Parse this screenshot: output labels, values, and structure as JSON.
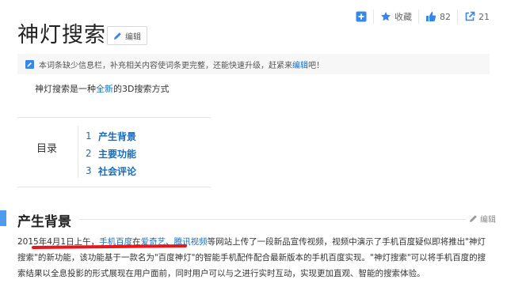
{
  "actions": {
    "add_icon": "plus-square-icon",
    "favorite": {
      "icon": "star-icon",
      "label": "收藏"
    },
    "like": {
      "icon": "thumbs-up-icon",
      "count": "82"
    },
    "share": {
      "icon": "share-icon",
      "count": "21"
    }
  },
  "page_title": "神灯搜索",
  "edit_label": "编辑",
  "notice": {
    "text_before": "本词条缺少信息栏，补充相关内容使词条更完整，还能快速升级，赶紧来",
    "link": "编辑",
    "text_after": "吧！"
  },
  "summary": {
    "before": "神灯搜索是一种",
    "link": "全新",
    "after": "的3D搜索方式"
  },
  "toc": {
    "label": "目录",
    "items": [
      {
        "num": "1",
        "label": "产生背景"
      },
      {
        "num": "2",
        "label": "主要功能"
      },
      {
        "num": "3",
        "label": "社会评论"
      }
    ]
  },
  "section": {
    "title": "产生背景",
    "edit_label": "编辑"
  },
  "paragraph": {
    "date": "2015年4月1日上午，",
    "link1": "手机百度",
    "t1": "在",
    "link2": "爱奇艺",
    "t2": "、",
    "link3": "腾讯视频",
    "t3": "等网站上传了一段新品宣传视频，视频中演示了手机百度疑似即将推出\"神灯搜索\"的新功能，该功能基于一款名为\"百度神灯\"的智能手机配件配合最新版本的手机百度实现。\"神灯搜索\"可以将手机百度的搜索结果以全息投影的形式展现在用户面前，同时用户可以与之进行实时互动，实现更加直观、智能的搜索体验。"
  },
  "colors": {
    "link": "#136ec2",
    "accent": "#4f9cee",
    "annotation": "#e8171b"
  }
}
